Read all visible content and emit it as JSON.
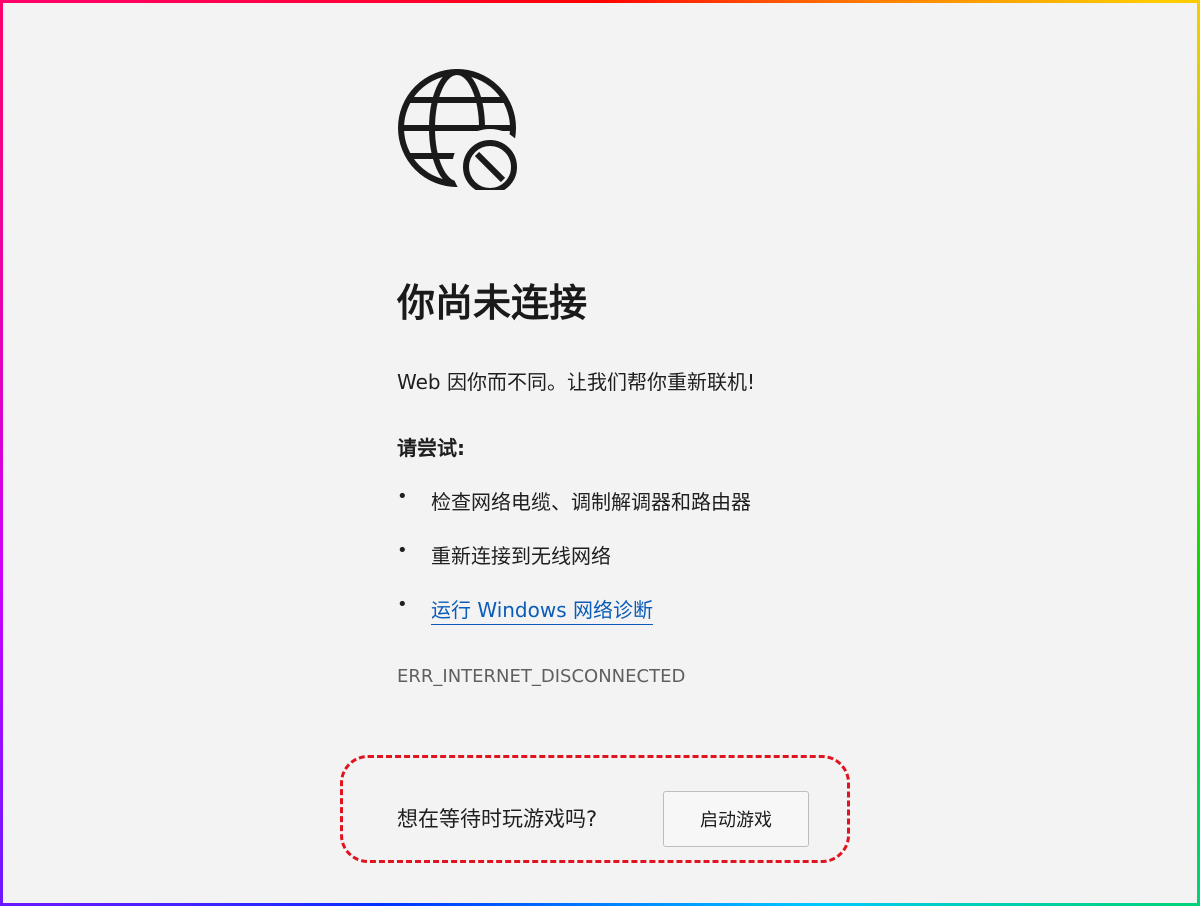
{
  "icons": {
    "globe": "globe-blocked-icon"
  },
  "main": {
    "title": "你尚未连接",
    "subtitle": "Web 因你而不同。让我们帮你重新联机!",
    "try_label": "请尝试:",
    "suggestions": [
      {
        "bullet": "•",
        "text": "检查网络电缆、调制解调器和路由器",
        "is_link": false
      },
      {
        "bullet": "•",
        "text": "重新连接到无线网络",
        "is_link": false
      },
      {
        "bullet": "•",
        "text": "运行 Windows 网络诊断",
        "is_link": true
      }
    ],
    "error_code": "ERR_INTERNET_DISCONNECTED"
  },
  "game": {
    "prompt": "想在等待时玩游戏吗?",
    "button_label": "启动游戏"
  },
  "colors": {
    "background": "#f3f3f3",
    "link": "#0b5cb8",
    "highlight_border": "#e0141e",
    "text": "#1f1f1f",
    "muted_text": "#5f5f5f"
  }
}
